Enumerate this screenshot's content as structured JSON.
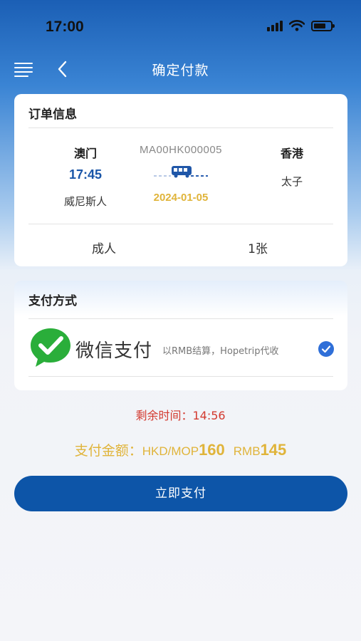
{
  "status_bar": {
    "time": "17:00"
  },
  "nav": {
    "title": "确定付款"
  },
  "order": {
    "title": "订单信息",
    "from": {
      "city": "澳门",
      "time": "17:45",
      "station": "威尼斯人"
    },
    "route_code": "MA00HK000005",
    "date": "2024-01-05",
    "to": {
      "city": "香港",
      "station": "太子"
    },
    "passenger_type": "成人",
    "ticket_count": "1张"
  },
  "payment": {
    "title": "支付方式",
    "method_label": "微信支付",
    "settle_note": "以RMB结算，Hopetrip代收",
    "selected": true
  },
  "countdown": {
    "label": "剩余时间：",
    "value": "14:56"
  },
  "amount": {
    "label": "支付金额：",
    "hkd_currency": "HKD/MOP",
    "hkd_value": "160",
    "rmb_currency": "RMB",
    "rmb_value": "145"
  },
  "pay_button": {
    "label": "立即支付"
  },
  "colors": {
    "primary": "#0d55a8",
    "accent_gold": "#e0b43a",
    "countdown_red": "#d33a2f",
    "wechat_green": "#2aae3a",
    "check_blue": "#2f6fd8"
  },
  "icons": {
    "menu": "menu-icon",
    "back": "back-icon",
    "bus": "bus-icon",
    "wechat": "wechat-icon",
    "check": "check-circle-icon"
  }
}
